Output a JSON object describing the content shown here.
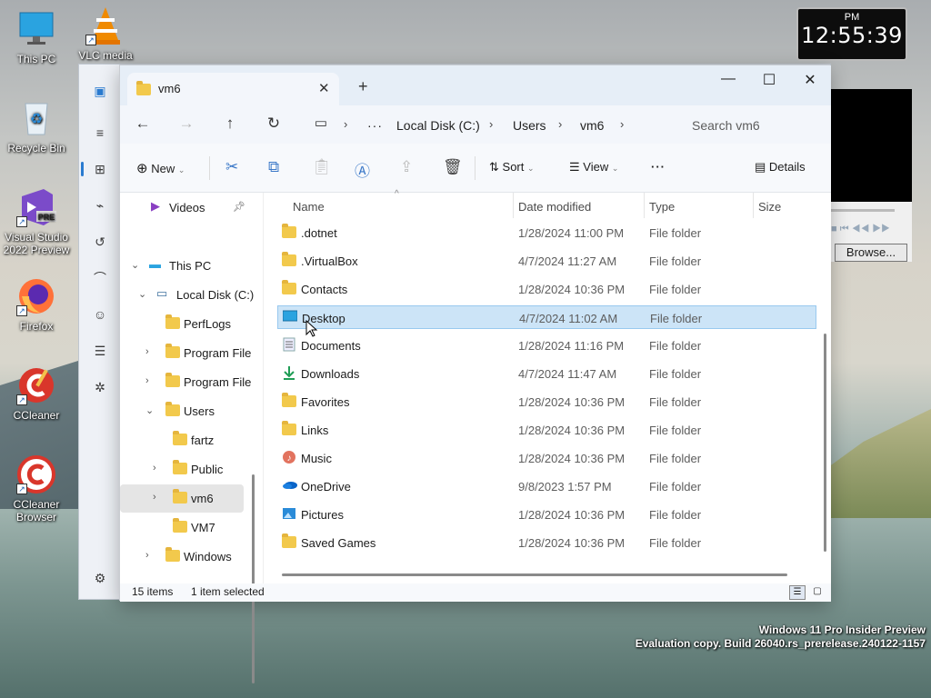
{
  "desktop": {
    "icons": [
      {
        "label": "This PC",
        "icon": "monitor-icon"
      },
      {
        "label": "VLC media",
        "icon": "vlc-cone-icon"
      },
      {
        "label": "Recycle Bin",
        "icon": "recycle-bin-icon"
      },
      {
        "label": "Visual Studio 2022 Preview",
        "icon": "visual-studio-icon",
        "badge": "PRE"
      },
      {
        "label": "Firefox",
        "icon": "firefox-icon"
      },
      {
        "label": "CCleaner",
        "icon": "ccleaner-icon"
      },
      {
        "label": "CCleaner Browser",
        "icon": "ccleaner-browser-icon"
      }
    ]
  },
  "clock": {
    "ampm": "PM",
    "time": "12:55:39"
  },
  "vlc": {
    "browse_label": "Browse..."
  },
  "watermark": {
    "line1": "Windows 11 Pro Insider Preview",
    "line2": "Evaluation copy. Build 26040.rs_prerelease.240122-1157"
  },
  "explorer": {
    "tab_title": "vm6",
    "breadcrumb": [
      "Local Disk (C:)",
      "Users",
      "vm6"
    ],
    "search_placeholder": "Search vm6",
    "toolbar": {
      "new_label": "New",
      "sort_label": "Sort",
      "view_label": "View",
      "details_label": "Details",
      "more": "···"
    },
    "nav": [
      {
        "label": "Videos",
        "indent": 0,
        "arrow": "",
        "pin": true
      },
      {
        "label": "This PC",
        "indent": 0,
        "arrow": "v"
      },
      {
        "label": "Local Disk (C:)",
        "indent": 1,
        "arrow": "v"
      },
      {
        "label": "PerfLogs",
        "indent": 2,
        "arrow": ""
      },
      {
        "label": "Program File",
        "indent": 2,
        "arrow": ">"
      },
      {
        "label": "Program File",
        "indent": 2,
        "arrow": ">"
      },
      {
        "label": "Users",
        "indent": 2,
        "arrow": "v"
      },
      {
        "label": "fartz",
        "indent": 3,
        "arrow": ""
      },
      {
        "label": "Public",
        "indent": 3,
        "arrow": ">"
      },
      {
        "label": "vm6",
        "indent": 3,
        "arrow": ">",
        "selected": true
      },
      {
        "label": "VM7",
        "indent": 3,
        "arrow": ""
      },
      {
        "label": "Windows",
        "indent": 2,
        "arrow": ">"
      }
    ],
    "columns": {
      "name": "Name",
      "date": "Date modified",
      "type": "Type",
      "size": "Size"
    },
    "files": [
      {
        "name": ".dotnet",
        "date": "1/28/2024 11:00 PM",
        "type": "File folder",
        "icon": "folder"
      },
      {
        "name": ".VirtualBox",
        "date": "4/7/2024 11:27 AM",
        "type": "File folder",
        "icon": "folder"
      },
      {
        "name": "Contacts",
        "date": "1/28/2024 10:36 PM",
        "type": "File folder",
        "icon": "folder"
      },
      {
        "name": "Desktop",
        "date": "4/7/2024 11:02 AM",
        "type": "File folder",
        "icon": "desktop",
        "selected": true
      },
      {
        "name": "Documents",
        "date": "1/28/2024 11:16 PM",
        "type": "File folder",
        "icon": "documents"
      },
      {
        "name": "Downloads",
        "date": "4/7/2024 11:47 AM",
        "type": "File folder",
        "icon": "downloads"
      },
      {
        "name": "Favorites",
        "date": "1/28/2024 10:36 PM",
        "type": "File folder",
        "icon": "folder"
      },
      {
        "name": "Links",
        "date": "1/28/2024 10:36 PM",
        "type": "File folder",
        "icon": "folder"
      },
      {
        "name": "Music",
        "date": "1/28/2024 10:36 PM",
        "type": "File folder",
        "icon": "music"
      },
      {
        "name": "OneDrive",
        "date": "9/8/2023 1:57 PM",
        "type": "File folder",
        "icon": "onedrive"
      },
      {
        "name": "Pictures",
        "date": "1/28/2024 10:36 PM",
        "type": "File folder",
        "icon": "pictures"
      },
      {
        "name": "Saved Games",
        "date": "1/28/2024 10:36 PM",
        "type": "File folder",
        "icon": "folder"
      }
    ],
    "status": {
      "count": "15 items",
      "selection": "1 item selected"
    }
  }
}
